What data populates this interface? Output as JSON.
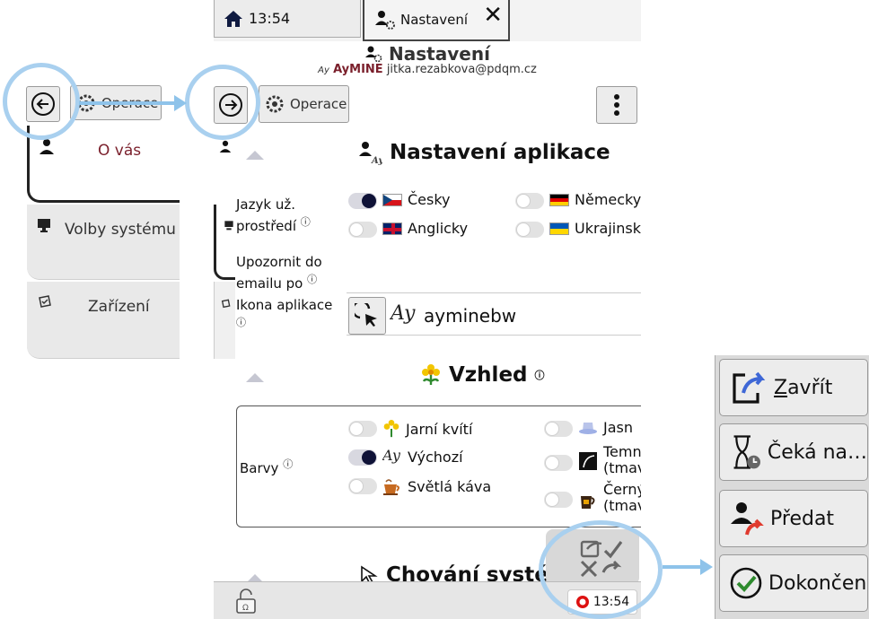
{
  "left_panel": {
    "operations_label": "Operace",
    "nav": [
      {
        "label": "O vás"
      },
      {
        "label": "Volby systému"
      },
      {
        "label": "Zařízení"
      }
    ]
  },
  "header": {
    "clock": "13:54",
    "active_tab": "Nastavení",
    "page_title": "Nastavení",
    "app_name": "AyMINE",
    "user_email": "jitka.rezabkova@pdqm.cz"
  },
  "toolbar": {
    "operations_label": "Operace"
  },
  "app_settings": {
    "title": "Nastavení aplikace",
    "language_label": "Jazyk už. prostředí",
    "languages": [
      {
        "label": "Česky",
        "on": true
      },
      {
        "label": "Německy",
        "on": false
      },
      {
        "label": "Anglicky",
        "on": false
      },
      {
        "label": "Ukrajinsk",
        "on": false
      }
    ],
    "email_notify_label": "Upozornit do emailu po",
    "app_icon_label": "Ikona aplikace",
    "app_icon_value": "ayminebw"
  },
  "appearance": {
    "title": "Vzhled",
    "colors_label": "Barvy",
    "options": [
      {
        "label": "Jarní kvítí",
        "on": false
      },
      {
        "label": "Jasn",
        "on": false
      },
      {
        "label": "Výchozí",
        "on": true
      },
      {
        "label": "Temn",
        "sub": "(tmav",
        "on": false
      },
      {
        "label": "Světlá káva",
        "on": false
      },
      {
        "label": "Černý",
        "sub": "(tmav",
        "on": false
      }
    ]
  },
  "behavior": {
    "title": "Chování systému"
  },
  "status_bar": {
    "clock": "13:54"
  },
  "actions": {
    "close": {
      "prefix": "Z",
      "rest": "avřít"
    },
    "waiting": "Čeká na…",
    "handover": "Předat",
    "complete": "Dokončen"
  },
  "colors": {
    "highlight": "#a9d0ef",
    "accent_text": "#7a1f2b",
    "toggle_on": "#0f1237"
  }
}
